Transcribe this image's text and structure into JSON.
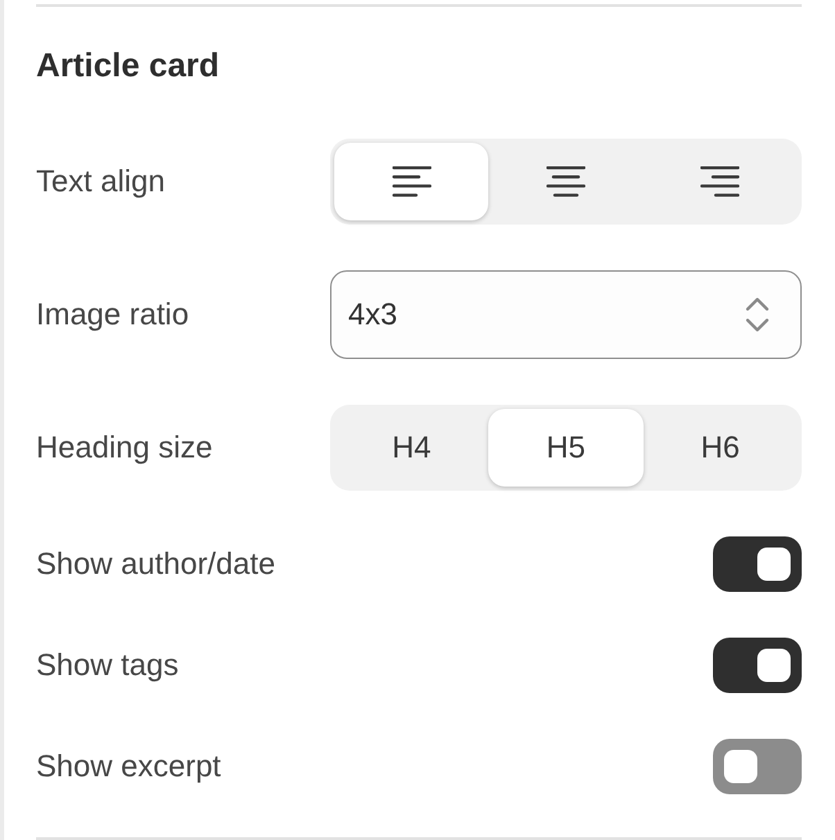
{
  "section": {
    "title": "Article card"
  },
  "settings": [
    {
      "kind": "segmented",
      "label": "Text align",
      "options": [
        {
          "kind": "left",
          "selected": true
        },
        {
          "kind": "center",
          "selected": false
        },
        {
          "kind": "right",
          "selected": false
        }
      ]
    },
    {
      "kind": "select",
      "label": "Image ratio",
      "value": "4x3"
    },
    {
      "kind": "segmented",
      "label": "Heading size",
      "options": [
        {
          "kind": "text",
          "label": "H4",
          "selected": false
        },
        {
          "kind": "text",
          "label": "H5",
          "selected": true
        },
        {
          "kind": "text",
          "label": "H6",
          "selected": false
        }
      ]
    },
    {
      "kind": "toggle",
      "label": "Show author/date",
      "on": true
    },
    {
      "kind": "toggle",
      "label": "Show tags",
      "on": true
    },
    {
      "kind": "toggle",
      "label": "Show excerpt",
      "on": false
    }
  ]
}
